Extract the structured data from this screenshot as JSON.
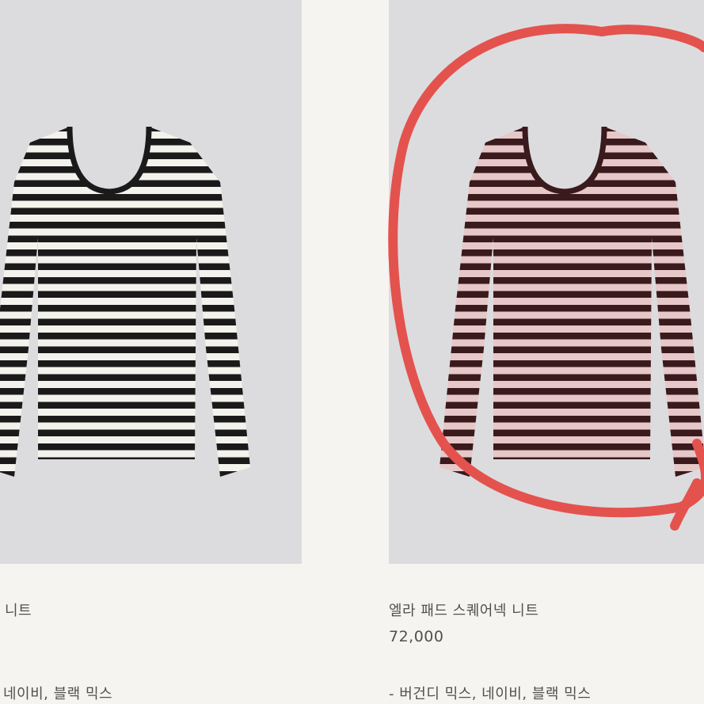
{
  "products": {
    "left": {
      "title": "니트",
      "colors": "네이비, 블랙 믹스",
      "stripe_dark": "#1a1a1a",
      "stripe_light": "#f4f2ec"
    },
    "right": {
      "title": "엘라 패드 스퀘어넥 니트",
      "price": "72,000",
      "colors": "- 버건디 믹스, 네이비, 블랙 믹스",
      "stripe_dark": "#3a1a1c",
      "stripe_light": "#e6c8c8"
    }
  },
  "annotation": {
    "type": "hand-drawn-circle",
    "color": "#e4524e"
  },
  "colors": {
    "background": "#f5f4f0",
    "image_bg": "#dcdcdf"
  }
}
